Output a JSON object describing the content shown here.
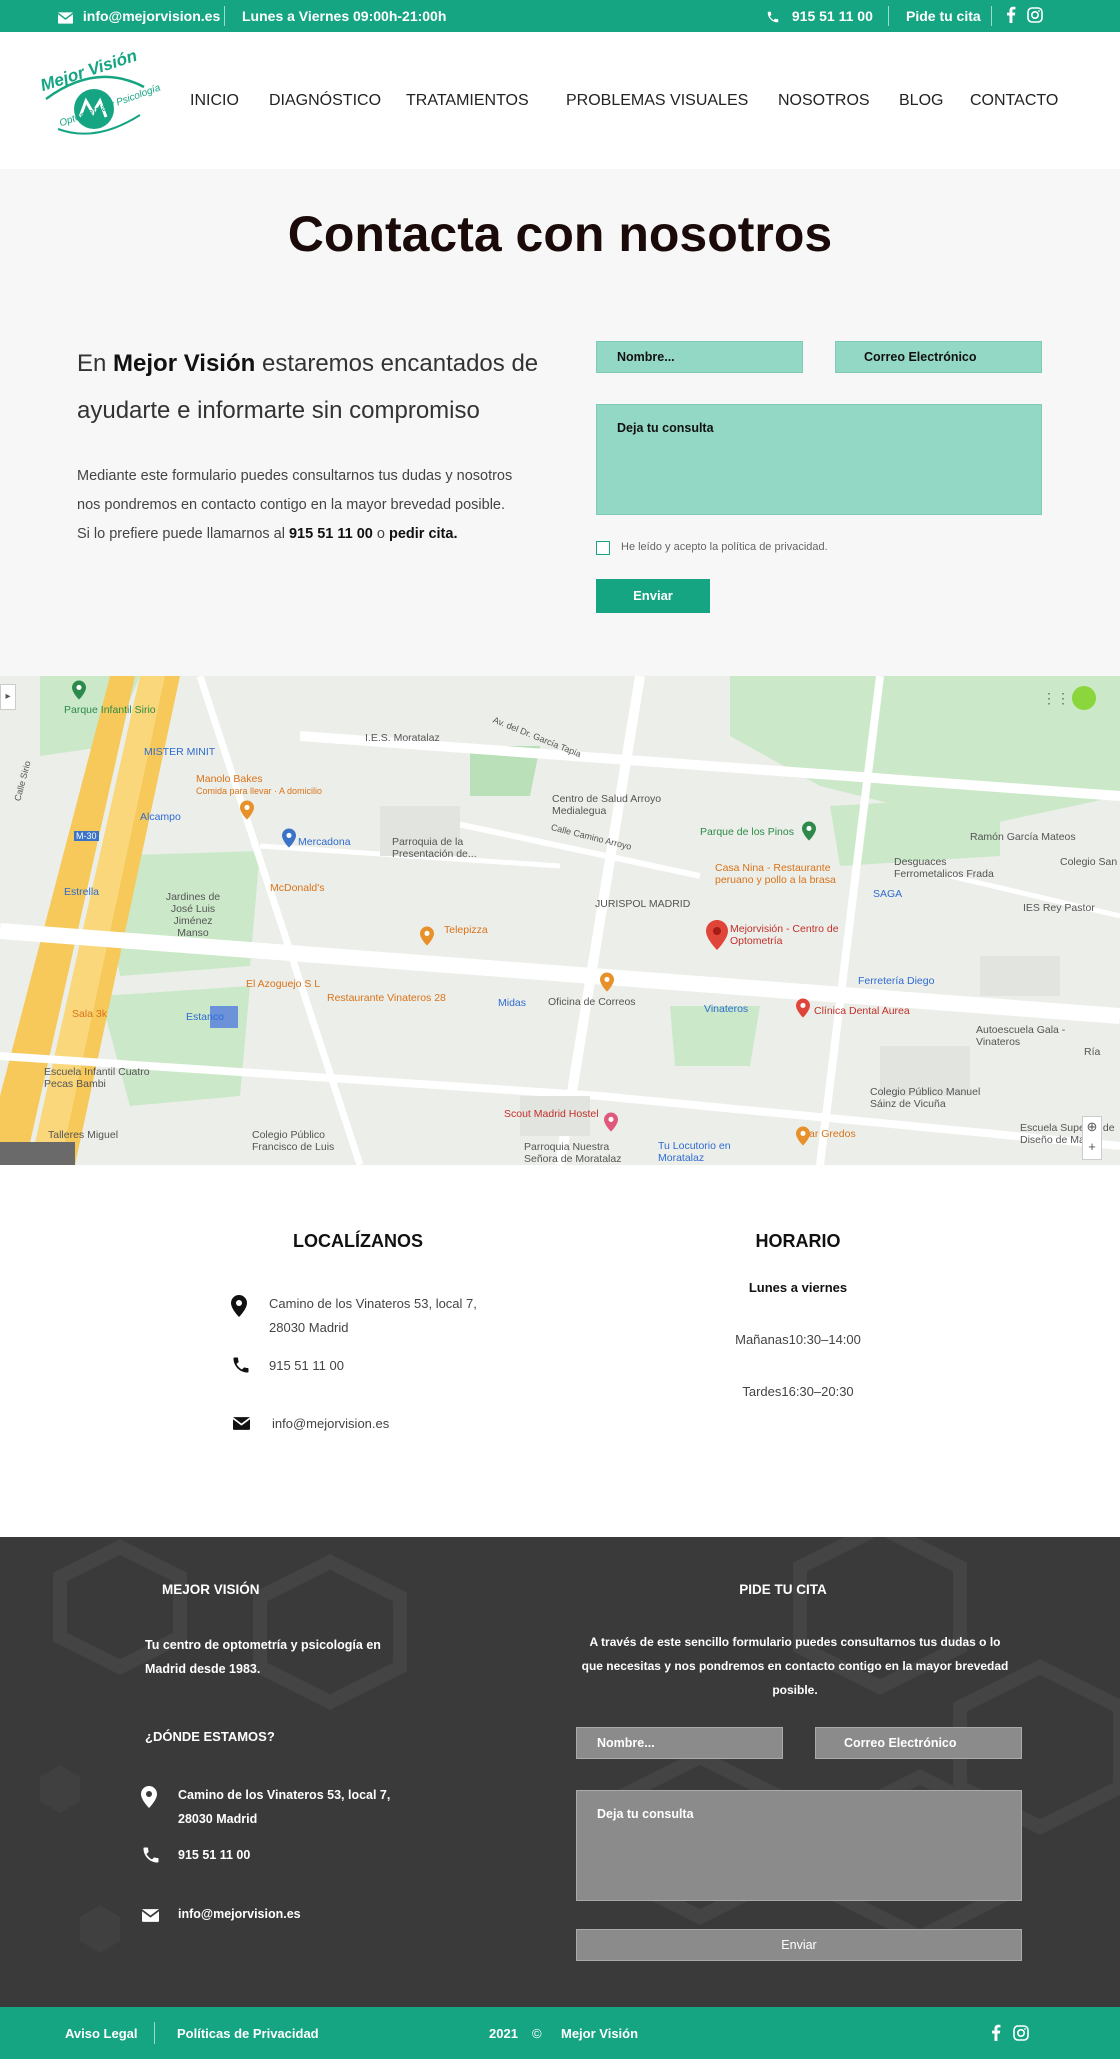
{
  "topbar": {
    "email": "info@mejorvision.es",
    "hours": "Lunes a Viernes 09:00h-21:00h",
    "phone": "915 51 11 00",
    "appointment": "Pide tu cita"
  },
  "logo": {
    "line1": "Mejor Visión",
    "line2": "Optometría y Psicología"
  },
  "nav": [
    "INICIO",
    "DIAGNÓSTICO",
    "TRATAMIENTOS",
    "PROBLEMAS VISUALES",
    "NOSOTROS",
    "BLOG",
    "CONTACTO"
  ],
  "contact": {
    "title": "Contacta con nosotros",
    "intro_pre": "En ",
    "intro_brand": "Mejor Visión",
    "intro_post": " estaremos encantados de ayudarte e informarte sin compromiso",
    "desc_pre": "Mediante este formulario puedes consultarnos tus dudas y nosotros nos pondremos en contacto contigo en la mayor brevedad posible. Si lo prefiere puede llamarnos al ",
    "desc_phone": "915 51 11 00",
    "desc_or": " o ",
    "desc_link": "pedir cita.",
    "form": {
      "name_placeholder": "Nombre...",
      "email_placeholder": "Correo Electrónico",
      "message_placeholder": "Deja tu consulta",
      "privacy": "He leído y acepto la política de privacidad.",
      "submit": "Enviar"
    }
  },
  "map": {
    "labels": [
      "Parque Infantil Sirio",
      "MISTER MINIT",
      "I.E.S. Moratalaz",
      "Manolo Bakes",
      "Comida para llevar · A domicilio",
      "Alcampo",
      "Mercadona",
      "Centro de Salud Arroyo Medialegua",
      "Parroquia de la Presentación de...",
      "Parque de los Pinos",
      "Ramón García Mateos",
      "Colegio San",
      "Desguaces Ferrometalicos Frada",
      "Casa Nina - Restaurante peruano y pollo a la brasa",
      "SAGA",
      "IES Rey Pastor",
      "Estrella",
      "Jardines de José Luis Jiménez Manso",
      "McDonald's",
      "JURISPOL MADRID",
      "Mejorvisión - Centro de Optometría",
      "Telepizza",
      "El Azoguejo S L",
      "Restaurante Vinateros 28",
      "Midas",
      "Oficina de Correos",
      "Vinateros",
      "Clínica Dental Aurea",
      "Ferretería Diego",
      "Autoescuela Gala - Vinateros",
      "Ría",
      "Sala 3k",
      "Estanco",
      "Escuela Infantil Cuatro Pecas Bambi",
      "Colegio Público Manuel Sáinz de Vicuña",
      "Scout Madrid Hostel",
      "Escuela Superior de Diseño de Madrid",
      "Talleres Miguel",
      "Colegio Público Francisco de Luis",
      "Parroquia Nuestra Señora de Moratalaz",
      "Tu Locutorio en Moratalaz",
      "Bar Gredos",
      "Av. del Dr. García Tapia",
      "Calle Camino Arroyo",
      "M-30",
      "Calle Sirio"
    ]
  },
  "location": {
    "title": "LOCALÍZANOS",
    "address1": "Camino de los Vinateros 53, local 7,",
    "address2": "28030 Madrid",
    "phone": "915 51 11 00",
    "email": "info@mejorvision.es"
  },
  "hours": {
    "title": "HORARIO",
    "days": "Lunes a viernes",
    "morning": "Mañanas10:30–14:00",
    "afternoon": "Tardes16:30–20:30"
  },
  "footer": {
    "brand": "MEJOR VISIÓN",
    "tagline1": "Tu centro de optometría y psicología en",
    "tagline2": "Madrid desde 1983.",
    "where": "¿DÓNDE ESTAMOS?",
    "address1": "Camino de los Vinateros 53, local 7,",
    "address2": "28030 Madrid",
    "phone": "915 51 11 00",
    "email": "info@mejorvision.es",
    "cta_title": "PIDE TU CITA",
    "cta_text1": "A través de este sencillo formulario puedes consultarnos tus dudas o lo",
    "cta_text2": "que necesitas y nos pondremos en contacto contigo en la mayor brevedad",
    "cta_text3": "posible.",
    "form": {
      "name_placeholder": "Nombre...",
      "email_placeholder": "Correo Electrónico",
      "message_placeholder": "Deja tu consulta",
      "submit": "Enviar"
    }
  },
  "bottombar": {
    "legal": "Aviso Legal",
    "privacy": "Políticas de Privacidad",
    "year": "2021",
    "copyright": "©",
    "brand": "Mejor Visión"
  },
  "colors": {
    "brand": "#16a583",
    "field": "#93d7c5",
    "footer": "#3a3a3a"
  },
  "icons": [
    "envelope-icon",
    "phone-icon",
    "facebook-icon",
    "instagram-icon",
    "map-pin-icon"
  ]
}
